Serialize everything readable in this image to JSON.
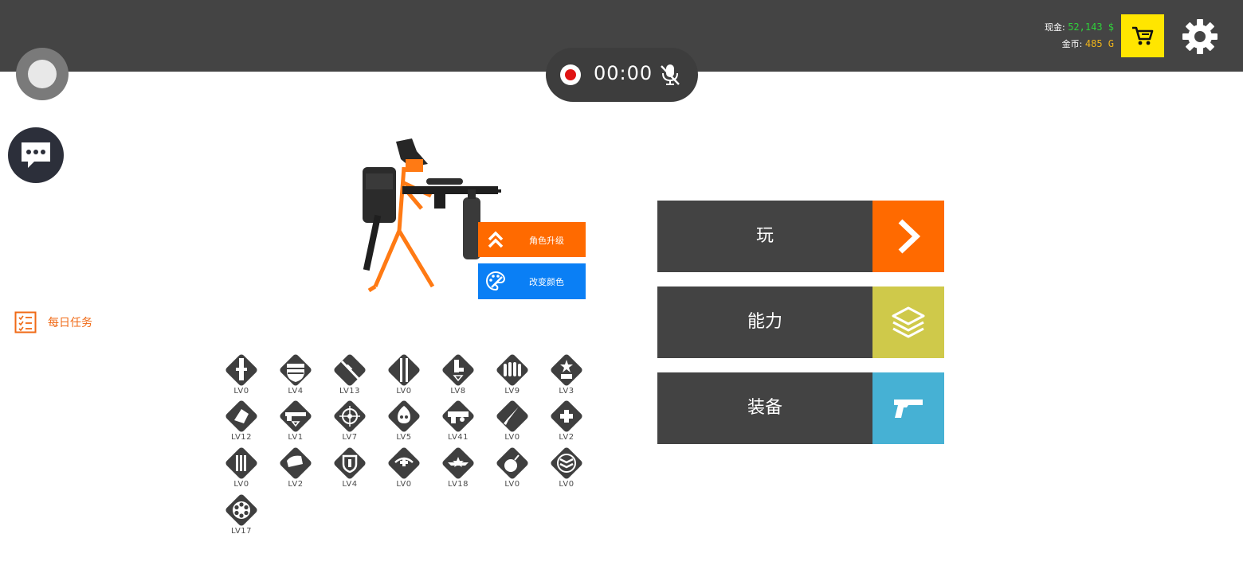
{
  "header": {
    "cash_label": "现金:",
    "cash_value": "52,143 $",
    "gold_label": "金币:",
    "gold_value": "485 G"
  },
  "recorder": {
    "time": "00:00"
  },
  "sidebar": {
    "daily_tasks": "每日任务"
  },
  "character": {
    "upgrade_label": "角色升级",
    "color_label": "改变颜色"
  },
  "skills": [
    {
      "level": "LV0",
      "icon": "grenade-icon"
    },
    {
      "level": "LV4",
      "icon": "shield-stripes-icon"
    },
    {
      "level": "LV13",
      "icon": "sniper-rifle-icon"
    },
    {
      "level": "LV0",
      "icon": "blade-icon"
    },
    {
      "level": "LV8",
      "icon": "pistol-down-icon"
    },
    {
      "level": "LV9",
      "icon": "bullets-icon"
    },
    {
      "level": "LV3",
      "icon": "star-badge-icon"
    },
    {
      "level": "LV12",
      "icon": "explosion-icon"
    },
    {
      "level": "LV1",
      "icon": "shotgun-icon"
    },
    {
      "level": "LV7",
      "icon": "crosshair-icon"
    },
    {
      "level": "LV5",
      "icon": "flaming-skull-icon"
    },
    {
      "level": "LV41",
      "icon": "heavy-gun-icon"
    },
    {
      "level": "LV0",
      "icon": "knife-icon"
    },
    {
      "level": "LV2",
      "icon": "medic-wings-icon"
    },
    {
      "level": "LV0",
      "icon": "ammo-belt-icon"
    },
    {
      "level": "LV2",
      "icon": "sniper-scope-icon"
    },
    {
      "level": "LV4",
      "icon": "armor-shield-icon"
    },
    {
      "level": "LV0",
      "icon": "medal-icon"
    },
    {
      "level": "LV18",
      "icon": "wing-badge-icon"
    },
    {
      "level": "LV0",
      "icon": "bomb-icon"
    },
    {
      "level": "LV0",
      "icon": "rank-chevrons-icon"
    },
    {
      "level": "LV17",
      "icon": "revolver-cylinder-icon"
    }
  ],
  "menu": {
    "play_label": "玩",
    "abilities_label": "能力",
    "equipment_label": "装备"
  },
  "colors": {
    "topbar": "#444444",
    "accent_orange": "#ff6a00",
    "accent_blue": "#0a7ff5",
    "play_side": "#ff6a00",
    "abilities_side": "#cfc94a",
    "equipment_side": "#46b1d4",
    "shop": "#ffe600"
  }
}
